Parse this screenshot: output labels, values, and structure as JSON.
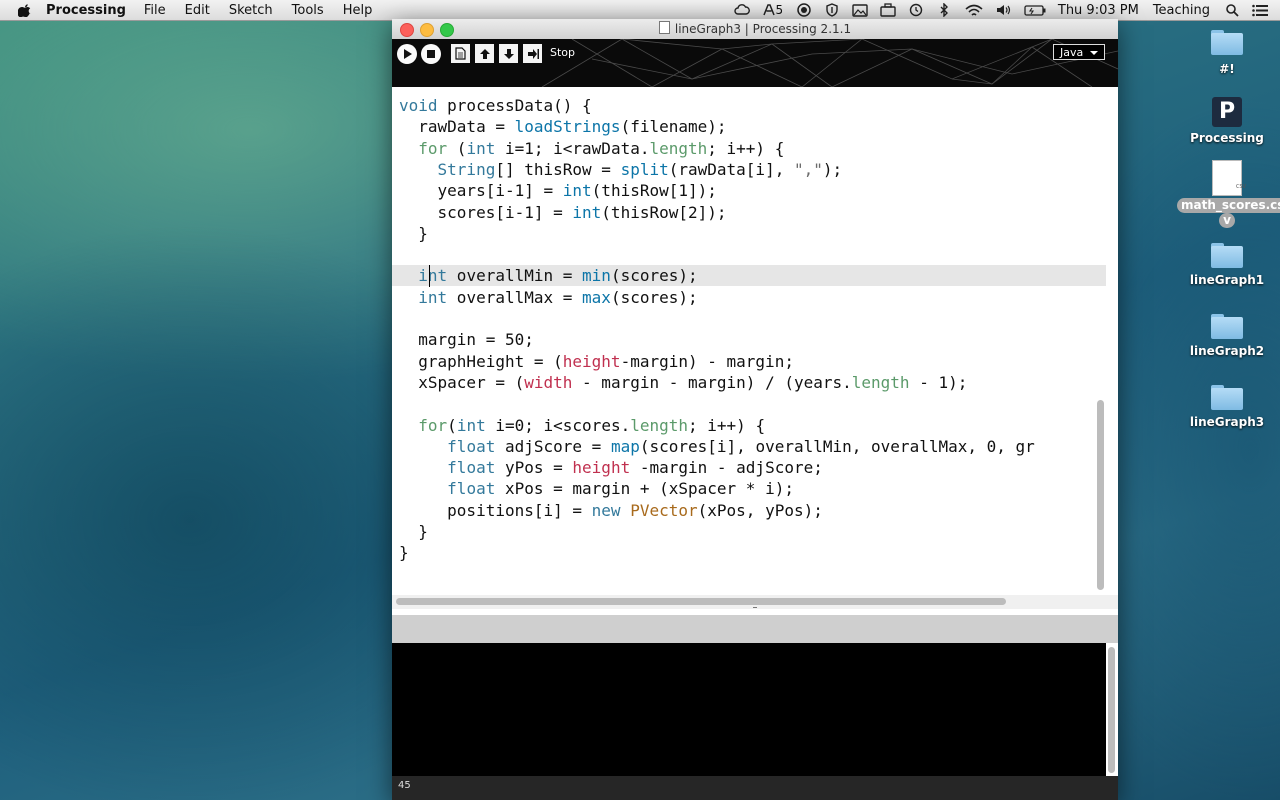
{
  "menubar": {
    "app_name": "Processing",
    "items": [
      "File",
      "Edit",
      "Sketch",
      "Tools",
      "Help"
    ],
    "adobe_badge": "5",
    "clock": "Thu 9:03 PM",
    "user": "Teaching"
  },
  "window": {
    "title": "lineGraph3 | Processing 2.1.1",
    "toolbar": {
      "stop_label": "Stop",
      "mode": "Java"
    },
    "active_tab": "lineGraph3",
    "highlighted_line": 9,
    "code_lines": [
      "void processData() {",
      "  rawData = loadStrings(filename);",
      "  for (int i=1; i<rawData.length; i++) {",
      "    String[] thisRow = split(rawData[i], \",\");",
      "    years[i-1] = int(thisRow[1]);",
      "    scores[i-1] = int(thisRow[2]);",
      "  }",
      "",
      "  int overallMin = min(scores);",
      "  int overallMax = max(scores);",
      "",
      "  margin = 50;",
      "  graphHeight = (height-margin) - margin;",
      "  xSpacer = (width - margin - margin) / (years.length - 1);",
      "",
      "  for(int i=0; i<scores.length; i++) {",
      "     float adjScore = map(scores[i], overallMin, overallMax, 0, gr",
      "     float yPos = height -margin - adjScore;",
      "     float xPos = margin + (xSpacer * i);",
      "     positions[i] = new PVector(xPos, yPos);",
      "  }",
      "}"
    ],
    "status_line": "45"
  },
  "desktop": {
    "icons": [
      {
        "label": "#!",
        "kind": "folder"
      },
      {
        "label": "Processing",
        "kind": "app"
      },
      {
        "label": "math_scores.cs",
        "label2": "v",
        "kind": "file",
        "ext": "CSV"
      },
      {
        "label": "lineGraph1",
        "kind": "folder"
      },
      {
        "label": "lineGraph2",
        "kind": "folder"
      },
      {
        "label": "lineGraph3",
        "kind": "folder"
      }
    ]
  }
}
